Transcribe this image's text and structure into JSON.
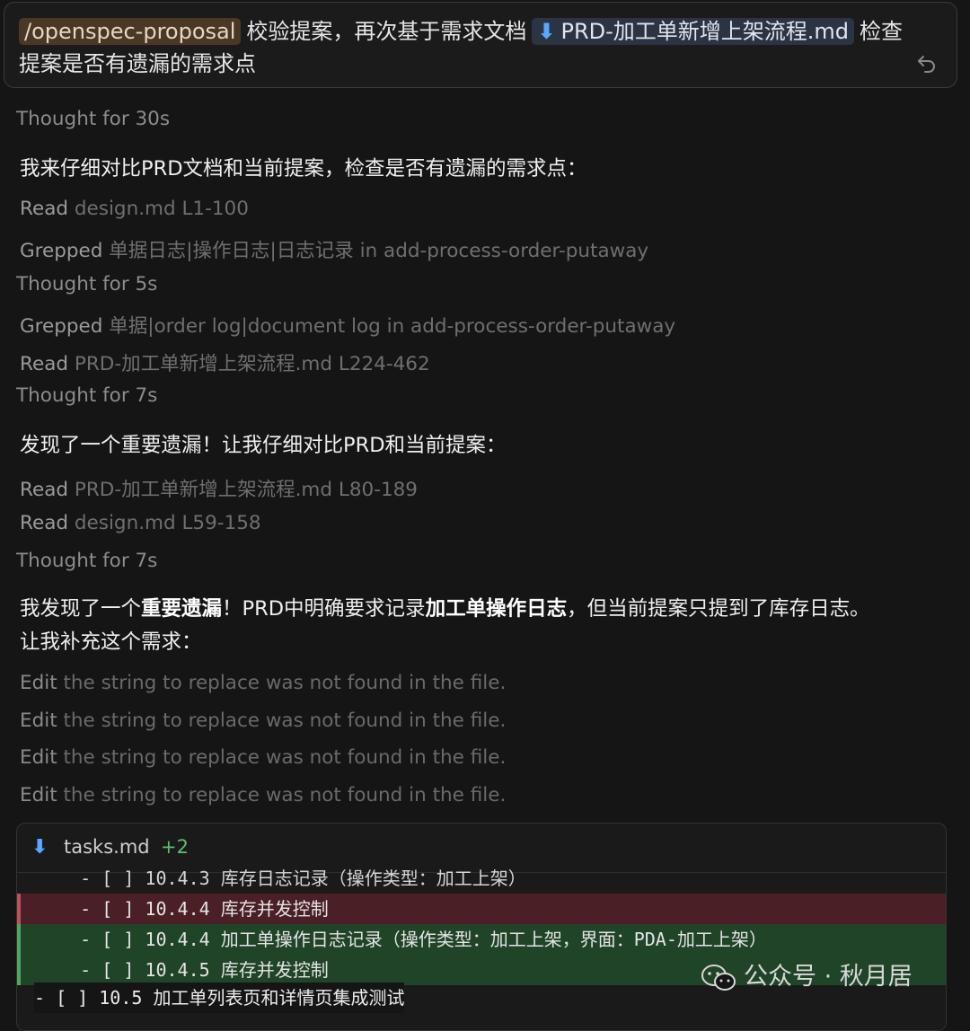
{
  "prompt": {
    "command": "/openspec-proposal",
    "text_before_file": "校验提案，再次基于需求文档",
    "file_chip": "PRD-加工单新增上架流程.md",
    "text_after_file": "检查",
    "line2": "提案是否有遗漏的需求点",
    "icons": [
      "download-arrow-icon",
      "undo-icon"
    ]
  },
  "steps": [
    {
      "kind": "thought",
      "label": "Thought",
      "detail": "for 30s"
    },
    {
      "kind": "message",
      "text": "我来仔细对比PRD文档和当前提案，检查是否有遗漏的需求点："
    },
    {
      "kind": "tool",
      "verb": "Read",
      "target": "design.md L1-100"
    },
    {
      "kind": "tool",
      "verb": "Grepped",
      "target": "单据日志|操作日志|日志记录 in add-process-order-putaway"
    },
    {
      "kind": "thought",
      "label": "Thought",
      "detail": "for 5s"
    },
    {
      "kind": "tool",
      "verb": "Grepped",
      "target": "单据|order log|document log in add-process-order-putaway"
    },
    {
      "kind": "tool",
      "verb": "Read",
      "target": "PRD-加工单新增上架流程.md L224-462"
    },
    {
      "kind": "thought",
      "label": "Thought",
      "detail": "for 7s"
    },
    {
      "kind": "message",
      "text": "发现了一个重要遗漏！让我仔细对比PRD和当前提案："
    },
    {
      "kind": "tool",
      "verb": "Read",
      "target": "PRD-加工单新增上架流程.md L80-189"
    },
    {
      "kind": "tool",
      "verb": "Read",
      "target": "design.md L59-158"
    },
    {
      "kind": "thought",
      "label": "Thought",
      "detail": "for 7s"
    }
  ],
  "final_message": {
    "p1": "我发现了一个",
    "b1": "重要遗漏",
    "p2": "！PRD中明确要求记录",
    "b2": "加工单操作日志",
    "p3": "，但当前提案只提到了库存日志。",
    "line2": "让我补充这个需求："
  },
  "edits": [
    {
      "verb": "Edit",
      "text": "the string to replace was not found in the file."
    },
    {
      "verb": "Edit",
      "text": "the string to replace was not found in the file."
    },
    {
      "verb": "Edit",
      "text": "the string to replace was not found in the file."
    },
    {
      "verb": "Edit",
      "text": "the string to replace was not found in the file."
    }
  ],
  "diff": {
    "file": "tasks.md",
    "added_count": "+2",
    "lines": [
      {
        "type": "context",
        "text": "    - [ ] 10.4.3 库存日志记录（操作类型：加工上架）"
      },
      {
        "type": "deleted",
        "text": "    - [ ] 10.4.4 库存并发控制"
      },
      {
        "type": "added",
        "text": "    - [ ] 10.4.4 加工单操作日志记录（操作类型：加工上架，界面：PDA-加工上架）"
      },
      {
        "type": "added",
        "text": "    - [ ] 10.4.5 库存并发控制"
      }
    ],
    "outer_line": "- [ ] 10.5 加工单列表页和详情页集成测试"
  },
  "watermark": {
    "text": "公众号 · 秋月居",
    "icon": "wechat-icon"
  },
  "colors": {
    "background": "#151515",
    "added_bg": "#1f4428",
    "deleted_bg": "#4a1f26",
    "link_blue": "#5aa7ff"
  }
}
